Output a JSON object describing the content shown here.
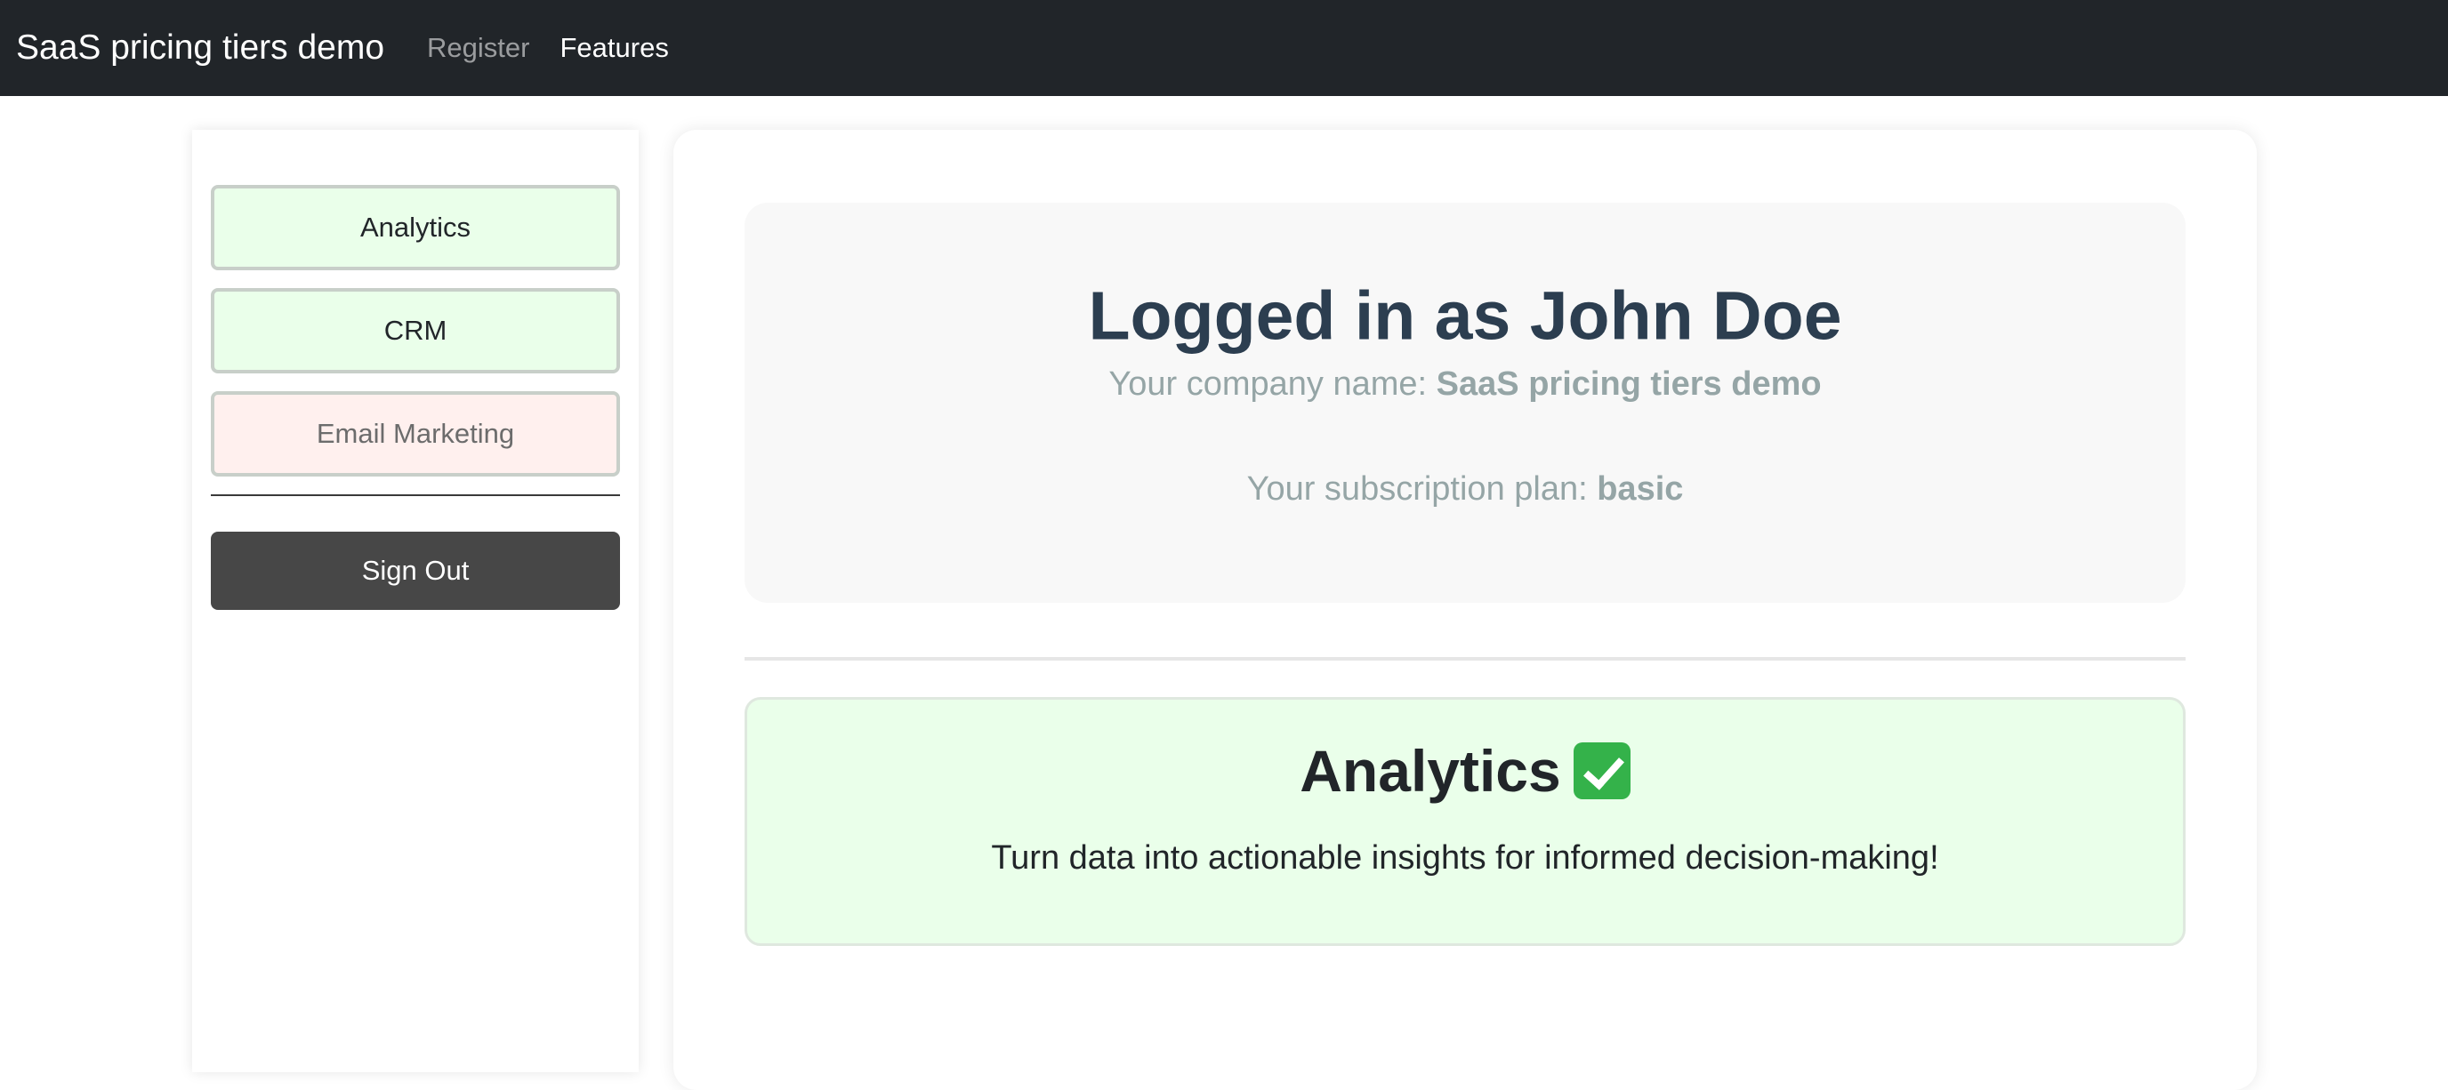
{
  "navbar": {
    "brand": "SaaS pricing tiers demo",
    "links": [
      {
        "label": "Register",
        "active": false
      },
      {
        "label": "Features",
        "active": true
      }
    ]
  },
  "sidebar": {
    "features": [
      {
        "label": "Analytics",
        "available": true
      },
      {
        "label": "CRM",
        "available": true
      },
      {
        "label": "Email Marketing",
        "available": false
      }
    ],
    "sign_out_label": "Sign Out"
  },
  "profile": {
    "title_prefix": "Logged in as",
    "user_name": "John Doe",
    "company_label": "Your company name:",
    "company_name": "SaaS pricing tiers demo",
    "plan_label": "Your subscription plan:",
    "plan": "basic"
  },
  "feature_card": {
    "title": "Analytics",
    "status_icon": "check-mark-icon",
    "description": "Turn data into actionable insights for informed decision-making!"
  },
  "colors": {
    "navbar_bg": "#212529",
    "available_bg": "#eaffea",
    "unavailable_bg": "#fff0ee",
    "sign_out_bg": "#474747",
    "title_color": "#2c3e50",
    "muted_text": "#95a5a6",
    "check_green": "#34b24a"
  }
}
